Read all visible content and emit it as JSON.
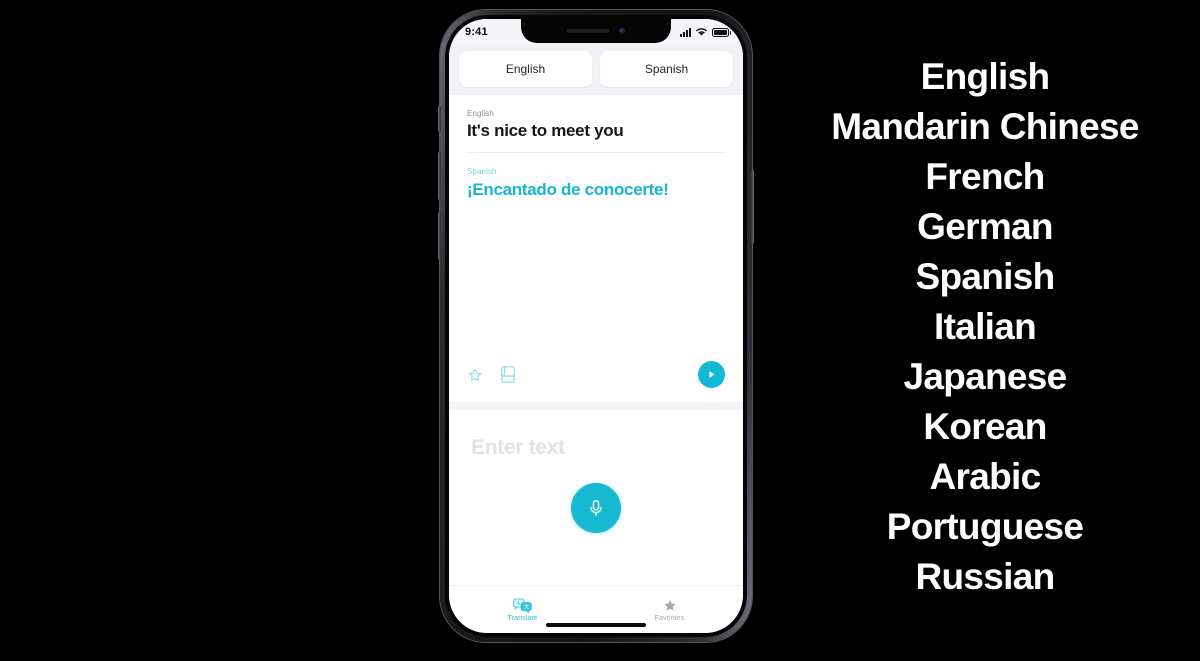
{
  "device": {
    "status_bar": {
      "time": "9:41",
      "signal_icon": "cellular-bars-icon",
      "wifi_icon": "wifi-icon",
      "battery_icon": "battery-icon"
    },
    "notch": {
      "speaker_icon": "earpiece-speaker-icon",
      "camera_icon": "front-camera-icon"
    }
  },
  "app": {
    "language_selector": {
      "source_language": "English",
      "target_language": "Spanish"
    },
    "translation": {
      "source_label": "English",
      "source_text": "It's nice to meet you",
      "target_label": "Spanish",
      "target_text": "¡Encantado de conocerte!",
      "actions": {
        "favorite_icon": "star-outline-icon",
        "dictionary_icon": "book-icon",
        "play_icon": "play-icon"
      }
    },
    "input": {
      "placeholder": "Enter text",
      "mic_icon": "microphone-icon"
    },
    "tabs": [
      {
        "label": "Translate",
        "icon": "translate-bubbles-icon",
        "active": true
      },
      {
        "label": "Favorites",
        "icon": "star-filled-icon",
        "active": false
      }
    ]
  },
  "languages": [
    "English",
    "Mandarin Chinese",
    "French",
    "German",
    "Spanish",
    "Italian",
    "Japanese",
    "Korean",
    "Arabic",
    "Portuguese",
    "Russian"
  ],
  "colors": {
    "accent_teal": "#17b5ce",
    "mic_teal": "#18b9d2",
    "background": "#000000",
    "screen_bg": "#ffffff",
    "segment_bg": "#f2f1f6"
  }
}
